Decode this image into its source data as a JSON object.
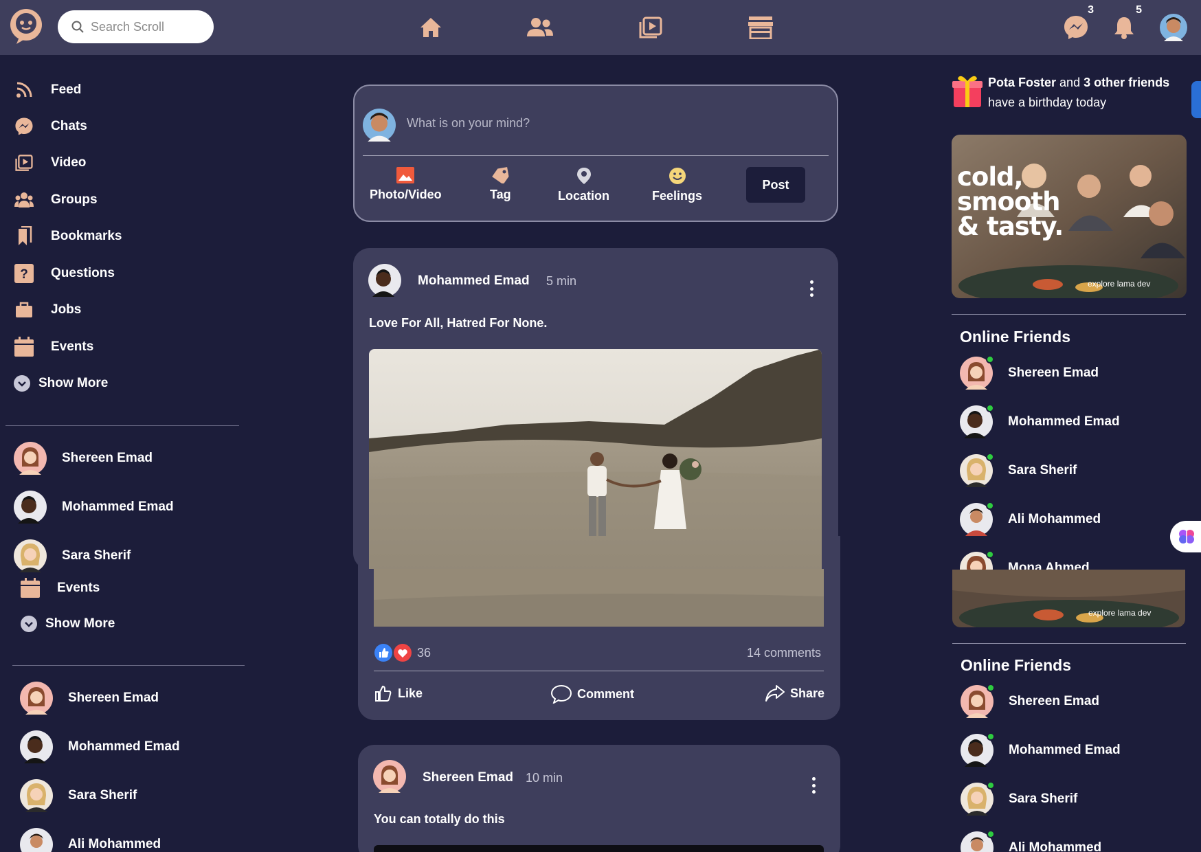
{
  "app": {
    "name": "Scroll"
  },
  "search": {
    "placeholder": "Search Scroll"
  },
  "topbar": {
    "nav_icons": [
      "home-icon",
      "friends-icon",
      "video-icon",
      "marketplace-icon"
    ],
    "messages_badge": "3",
    "notifications_badge": "5"
  },
  "sidebar": {
    "items": [
      {
        "label": "Feed",
        "icon": "rss-icon"
      },
      {
        "label": "Chats",
        "icon": "messenger-icon"
      },
      {
        "label": "Video",
        "icon": "video-icon"
      },
      {
        "label": "Groups",
        "icon": "groups-icon"
      },
      {
        "label": "Bookmarks",
        "icon": "bookmark-icon"
      },
      {
        "label": "Questions",
        "icon": "question-icon"
      },
      {
        "label": "Jobs",
        "icon": "briefcase-icon"
      },
      {
        "label": "Events",
        "icon": "calendar-icon"
      }
    ],
    "show_more": "Show More",
    "friends_a": [
      "Shereen Emad",
      "Mohammed Emad",
      "Sara Sherif"
    ],
    "events_label": "Events",
    "show_more_2": "Show More",
    "friends_b": [
      "Shereen Emad",
      "Mohammed Emad",
      "Sara Sherif",
      "Ali Mohammed"
    ]
  },
  "composer": {
    "placeholder": "What is on your mind?",
    "actions": [
      "Photo/Video",
      "Tag",
      "Location",
      "Feelings"
    ],
    "post_label": "Post"
  },
  "posts": [
    {
      "author": "Mohammed Emad",
      "time": "5 min",
      "text": "Love For All, Hatred For None.",
      "likes": "36",
      "comments": "14 comments",
      "actions": [
        "Like",
        "Comment",
        "Share"
      ]
    },
    {
      "author": "Shereen Emad",
      "time": "10 min",
      "text": "You can totally do this"
    }
  ],
  "rightbar": {
    "birthday": {
      "name": "Pota Foster",
      "and": "and",
      "others": "3 other friends",
      "suffix": "have a birthday today"
    },
    "ad": {
      "headline_1": "cold,",
      "headline_2": "smooth",
      "headline_3": "& tasty.",
      "caption": "explore lama dev"
    },
    "online_title": "Online Friends",
    "online_a": [
      "Shereen Emad",
      "Mohammed Emad",
      "Sara Sherif",
      "Ali Mohammed",
      "Mona Ahmed"
    ],
    "online_title_2": "Online Friends",
    "online_b": [
      "Shereen Emad",
      "Mohammed Emad",
      "Sara Sherif",
      "Ali Mohammed"
    ]
  },
  "colors": {
    "background": "#1c1d3a",
    "card": "#3e3e5c",
    "online": "#2ecc40",
    "like_blue": "#3b82f6",
    "heart_red": "#ef4444"
  }
}
